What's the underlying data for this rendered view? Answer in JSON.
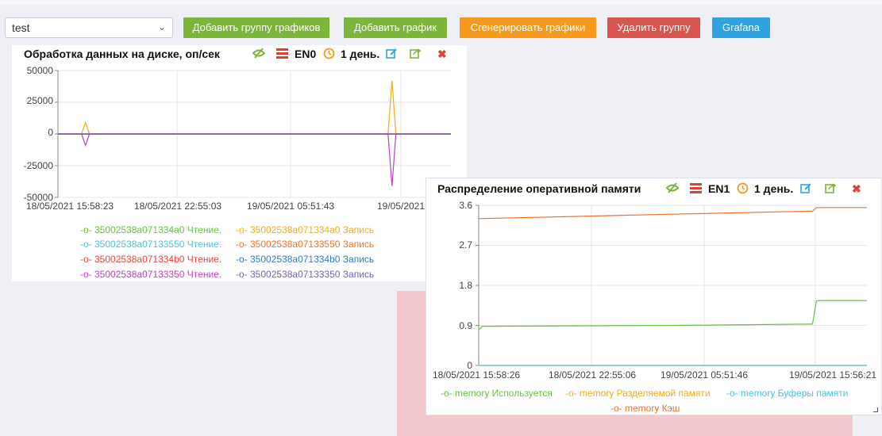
{
  "toolbar": {
    "group_select_value": "test",
    "add_group_label": "Добавить группу графиков",
    "add_chart_label": "Добавить график",
    "generate_label": "Сгенерировать графики",
    "delete_group_label": "Удалить группу",
    "grafana_label": "Grafana"
  },
  "colors": {
    "green_button": "#7bb53a",
    "orange_button": "#f79a1b",
    "red_button": "#d9534f",
    "blue_button": "#2fa3e2",
    "pink_area": "#f2c8cc"
  },
  "panels": [
    {
      "title": "Обработка данных на диске, оп/сек",
      "node": "EN0",
      "period": "1 день.",
      "icons": [
        "visibility-off-icon",
        "server-icon",
        "clock-icon",
        "edit-icon",
        "export-icon",
        "close-icon"
      ]
    },
    {
      "title": "Распределение оперативной памяти",
      "node": "EN1",
      "period": "1 день.",
      "icons": [
        "visibility-off-icon",
        "server-icon",
        "clock-icon",
        "edit-icon",
        "export-icon",
        "close-icon"
      ]
    }
  ],
  "chart_data": [
    {
      "type": "line",
      "title": "Обработка данных на диске, оп/сек",
      "x_ticks": [
        "18/05/2021 15:58:23",
        "18/05/2021 22:55:03",
        "19/05/2021 05:51:43",
        "19/05/2021"
      ],
      "y_ticks": [
        "50000",
        "25000",
        "0",
        "-25000",
        "-50000"
      ],
      "ylim": [
        -50000,
        50000
      ],
      "grid": true,
      "legend_placement": "bottom",
      "series": [
        {
          "name": "35002538a071334a0 Чтение.",
          "color": "#6abf45",
          "x": [
            0,
            1
          ],
          "y": [
            0,
            0
          ]
        },
        {
          "name": "35002538a071334a0 Запись",
          "color": "#f0ad1a",
          "x": [
            0,
            0.06,
            0.07,
            0.08,
            0.84,
            0.85,
            0.86,
            1
          ],
          "y": [
            0,
            0,
            9000,
            0,
            0,
            42000,
            0,
            0
          ]
        },
        {
          "name": "35002538a07133550 Чтение.",
          "color": "#4fc3d9",
          "x": [
            0,
            1
          ],
          "y": [
            0,
            0
          ]
        },
        {
          "name": "35002538a07133550 Запись",
          "color": "#f0702a",
          "x": [
            0,
            1
          ],
          "y": [
            0,
            0
          ]
        },
        {
          "name": "35002538a071334b0 Чтение.",
          "color": "#e8443a",
          "x": [
            0,
            1
          ],
          "y": [
            0,
            0
          ]
        },
        {
          "name": "35002538a071334b0 Запись",
          "color": "#2f79c9",
          "x": [
            0,
            1
          ],
          "y": [
            0,
            0
          ]
        },
        {
          "name": "35002538a07133350 Чтение.",
          "color": "#c43cc4",
          "x": [
            0,
            0.06,
            0.07,
            0.08,
            0.84,
            0.85,
            0.86,
            1
          ],
          "y": [
            0,
            0,
            -9000,
            0,
            0,
            -41000,
            0,
            0
          ]
        },
        {
          "name": "35002538a07133350 Запись",
          "color": "#7a5fb5",
          "x": [
            0,
            1
          ],
          "y": [
            0,
            0
          ]
        }
      ]
    },
    {
      "type": "line",
      "title": "Распределение оперативной памяти",
      "x_ticks": [
        "18/05/2021 15:58:26",
        "18/05/2021 22:55:06",
        "19/05/2021 05:51:46",
        "19/05/2021 15:56:21"
      ],
      "y_ticks": [
        "3.6",
        "2.7",
        "1.8",
        "0.9",
        "0"
      ],
      "ylim": [
        0,
        3.6
      ],
      "grid": true,
      "legend_placement": "bottom",
      "series": [
        {
          "name": "memory Используется",
          "color": "#6abf45",
          "x": [
            0,
            0.01,
            0.02,
            0.5,
            0.86,
            0.87,
            0.875,
            1
          ],
          "y": [
            0.8,
            0.88,
            0.88,
            0.9,
            0.93,
            1.45,
            1.46,
            1.46
          ]
        },
        {
          "name": "memory Разделяемой памяти",
          "color": "#f0ad1a",
          "x": [
            0,
            1
          ],
          "y": [
            0,
            0
          ]
        },
        {
          "name": "memory Буферы памяти",
          "color": "#4fc3d9",
          "x": [
            0,
            1
          ],
          "y": [
            0,
            0
          ]
        },
        {
          "name": "memory Кэш",
          "color": "#f0702a",
          "x": [
            0,
            0.5,
            0.86,
            0.87,
            1
          ],
          "y": [
            3.3,
            3.4,
            3.47,
            3.55,
            3.55
          ]
        }
      ]
    }
  ]
}
